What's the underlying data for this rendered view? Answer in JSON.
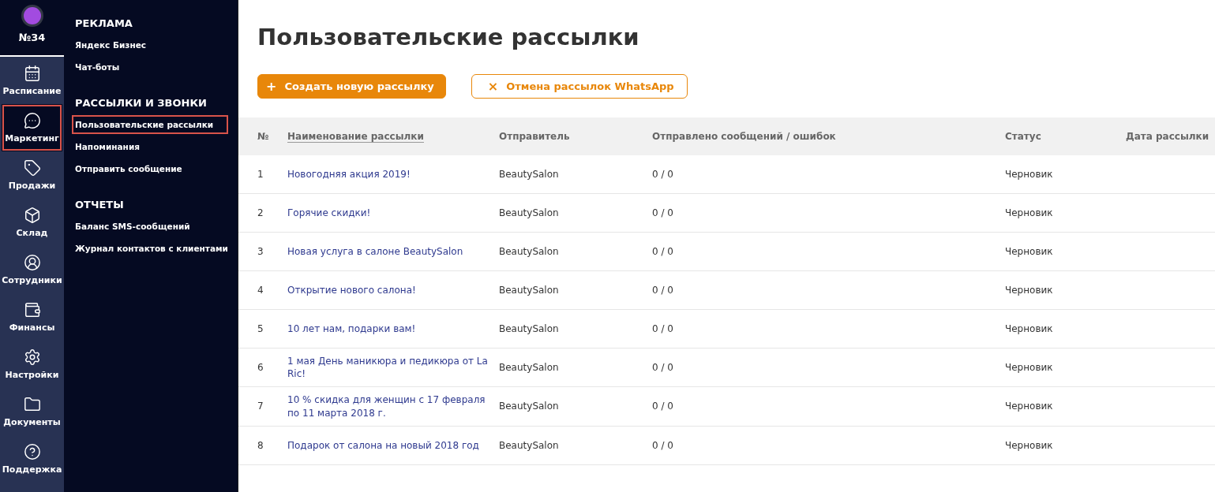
{
  "account": {
    "number": "№34"
  },
  "rail": [
    {
      "label": "Расписание",
      "selected": false,
      "highlighted": false
    },
    {
      "label": "Маркетинг",
      "selected": true,
      "highlighted": true
    },
    {
      "label": "Продажи",
      "selected": false,
      "highlighted": false
    },
    {
      "label": "Склад",
      "selected": false,
      "highlighted": false
    },
    {
      "label": "Сотрудники",
      "selected": false,
      "highlighted": false
    },
    {
      "label": "Финансы",
      "selected": false,
      "highlighted": false
    },
    {
      "label": "Настройки",
      "selected": false,
      "highlighted": false
    },
    {
      "label": "Документы",
      "selected": false,
      "highlighted": false
    },
    {
      "label": "Поддержка",
      "selected": false,
      "highlighted": false
    }
  ],
  "submenu": [
    {
      "title": "РЕКЛАМА",
      "items": [
        {
          "label": "Яндекс Бизнес",
          "highlighted": false
        },
        {
          "label": "Чат-боты",
          "highlighted": false
        }
      ]
    },
    {
      "title": "РАССЫЛКИ И ЗВОНКИ",
      "items": [
        {
          "label": "Пользовательские рассылки",
          "highlighted": true
        },
        {
          "label": "Напоминания",
          "highlighted": false
        },
        {
          "label": "Отправить сообщение",
          "highlighted": false
        }
      ]
    },
    {
      "title": "ОТЧЕТЫ",
      "items": [
        {
          "label": "Баланс SMS-сообщений",
          "highlighted": false
        },
        {
          "label": "Журнал контактов с клиентами",
          "highlighted": false
        }
      ]
    }
  ],
  "page_title": "Пользовательские рассылки",
  "buttons": [
    {
      "label": "Создать новую рассылку",
      "kind": "primary",
      "icon": "+"
    },
    {
      "label": "Отмена рассылок WhatsApp",
      "kind": "outline",
      "icon": "×"
    }
  ],
  "table": {
    "columns": [
      {
        "label": "№",
        "sortable": false
      },
      {
        "label": "Наименование рассылки",
        "sortable": true
      },
      {
        "label": "Отправитель",
        "sortable": false
      },
      {
        "label": "Отправлено сообщений / ошибок",
        "sortable": false
      },
      {
        "label": "Статус",
        "sortable": false
      },
      {
        "label": "Дата рассылки",
        "sortable": false
      }
    ],
    "rows": [
      [
        "1",
        "Новогодняя акция 2019!",
        "BeautySalon",
        "0 / 0",
        "Черновик"
      ],
      [
        "2",
        "Горячие скидки!",
        "BeautySalon",
        "0 / 0",
        "Черновик"
      ],
      [
        "3",
        "Новая услуга в салоне BeautySalon",
        "BeautySalon",
        "0 / 0",
        "Черновик"
      ],
      [
        "4",
        "Открытие нового салона!",
        "BeautySalon",
        "0 / 0",
        "Черновик"
      ],
      [
        "5",
        "10 лет нам, подарки вам!",
        "BeautySalon",
        "0 / 0",
        "Черновик"
      ],
      [
        "6",
        "1 мая День маникюра и педикюра от La Ric!",
        "BeautySalon",
        "0 / 0",
        "Черновик"
      ],
      [
        "7",
        "10 % скидка для женщин с 17 февраля по 11 марта 2018 г.",
        "BeautySalon",
        "0 / 0",
        "Черновик"
      ],
      [
        "8",
        "Подарок от салона на новый 2018 год",
        "BeautySalon",
        "0 / 0",
        "Черновик"
      ]
    ]
  }
}
